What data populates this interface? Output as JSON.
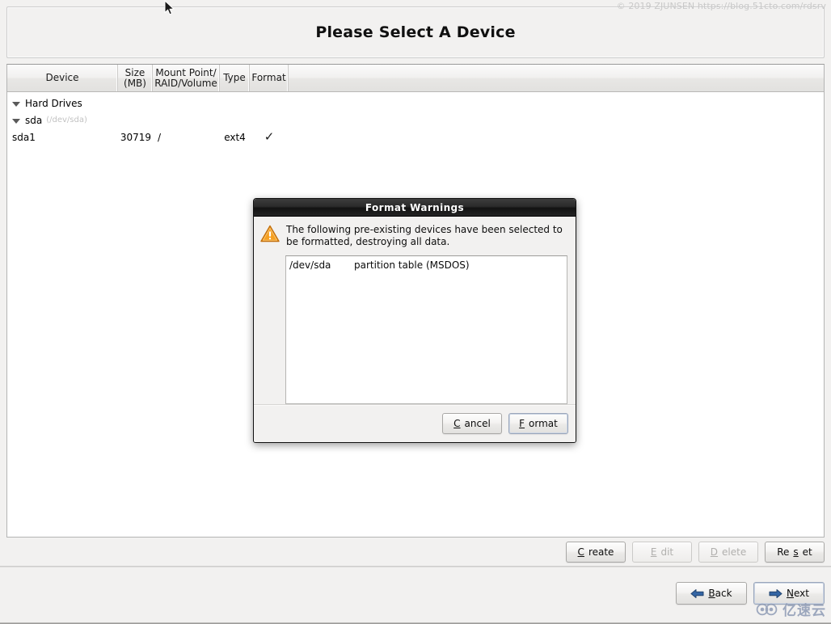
{
  "watermark": {
    "top_text": "© 2019 ZJUNSEN https://blog.51cto.com/rdsrv",
    "logo_text": "亿速云",
    "logo_icon": "cloud-icon"
  },
  "header": {
    "title": "Please Select A Device"
  },
  "device_table": {
    "columns": [
      {
        "label": "Device"
      },
      {
        "label": "Size\n(MB)",
        "line1": "Size",
        "line2": "(MB)"
      },
      {
        "label": "Mount Point/\nRAID/Volume",
        "line1": "Mount Point/",
        "line2": "RAID/Volume"
      },
      {
        "label": "Type"
      },
      {
        "label": "Format"
      }
    ],
    "rows": [
      {
        "indent": 0,
        "expander": "triangle-down-icon",
        "device": "Hard Drives",
        "device_sub": "",
        "size": "",
        "mount": "",
        "type": "",
        "format": ""
      },
      {
        "indent": 1,
        "expander": "triangle-down-icon",
        "device": "sda",
        "device_sub": "(/dev/sda)",
        "size": "",
        "mount": "",
        "type": "",
        "format": ""
      },
      {
        "indent": 2,
        "expander": "",
        "device": "sda1",
        "device_sub": "",
        "size": "30719",
        "mount": "/",
        "type": "ext4",
        "format": "✓"
      }
    ]
  },
  "action_bar": {
    "buttons": [
      {
        "label": "Create",
        "mnemonic": "C",
        "pre": "",
        "post": "reate",
        "enabled": true
      },
      {
        "label": "Edit",
        "mnemonic": "E",
        "pre": "",
        "post": "dit",
        "enabled": false
      },
      {
        "label": "Delete",
        "mnemonic": "D",
        "pre": "",
        "post": "elete",
        "enabled": false
      },
      {
        "label": "Reset",
        "mnemonic": "s",
        "pre": "Re",
        "post": "et",
        "enabled": true
      }
    ]
  },
  "navigation": {
    "back": {
      "label": "Back",
      "pre": "",
      "mnemonic": "B",
      "post": "ack",
      "icon": "arrow-left-icon"
    },
    "next": {
      "label": "Next",
      "pre": "",
      "mnemonic": "N",
      "post": "ext",
      "icon": "arrow-right-icon"
    }
  },
  "dialog": {
    "title": "Format Warnings",
    "icon": "warning-triangle-icon",
    "message": "The following pre-existing devices have been selected to be formatted, destroying all data.",
    "list": [
      {
        "device": "/dev/sda",
        "description": "partition table (MSDOS)"
      }
    ],
    "buttons": [
      {
        "label": "Cancel",
        "pre": "",
        "mnemonic": "C",
        "post": "ancel",
        "default": false
      },
      {
        "label": "Format",
        "pre": "",
        "mnemonic": "F",
        "post": "ormat",
        "default": true
      }
    ]
  },
  "colors": {
    "window_bg": "#f2f1f0",
    "panel_white": "#ffffff",
    "dialog_titlebar": "#121212",
    "warning_orange": "#f0a030",
    "arrow_blue": "#3465a4",
    "watermark_gray": "#c8c8c8"
  }
}
